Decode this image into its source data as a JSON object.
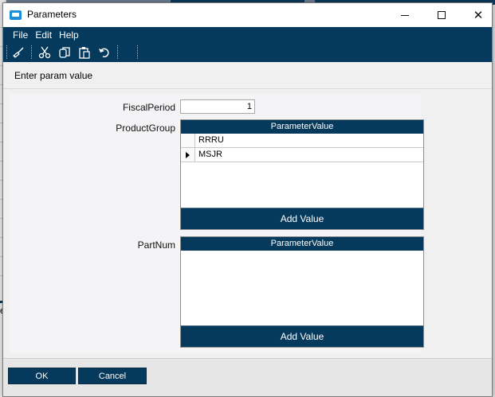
{
  "window": {
    "title": "Parameters",
    "close_glyph": "✕"
  },
  "menu": {
    "items": [
      "File",
      "Edit",
      "Help"
    ]
  },
  "toolbar": {
    "icons": [
      "broom-icon",
      "cut-icon",
      "copy-icon",
      "paste-icon",
      "undo-icon"
    ]
  },
  "prompt": {
    "text": "Enter param value"
  },
  "fields": {
    "fiscal_period": {
      "label": "FiscalPeriod",
      "value": "1"
    },
    "product_group": {
      "label": "ProductGroup",
      "column_header": "ParameterValue",
      "rows": [
        "RRRU",
        "MSJR"
      ],
      "add_label": "Add Value"
    },
    "part_num": {
      "label": "PartNum",
      "column_header": "ParameterValue",
      "rows": [],
      "add_label": "Add Value"
    }
  },
  "buttons": {
    "ok": "OK",
    "cancel": "Cancel"
  },
  "colors": {
    "accent": "#063a5c",
    "window_bg": "#f0f0f0"
  }
}
